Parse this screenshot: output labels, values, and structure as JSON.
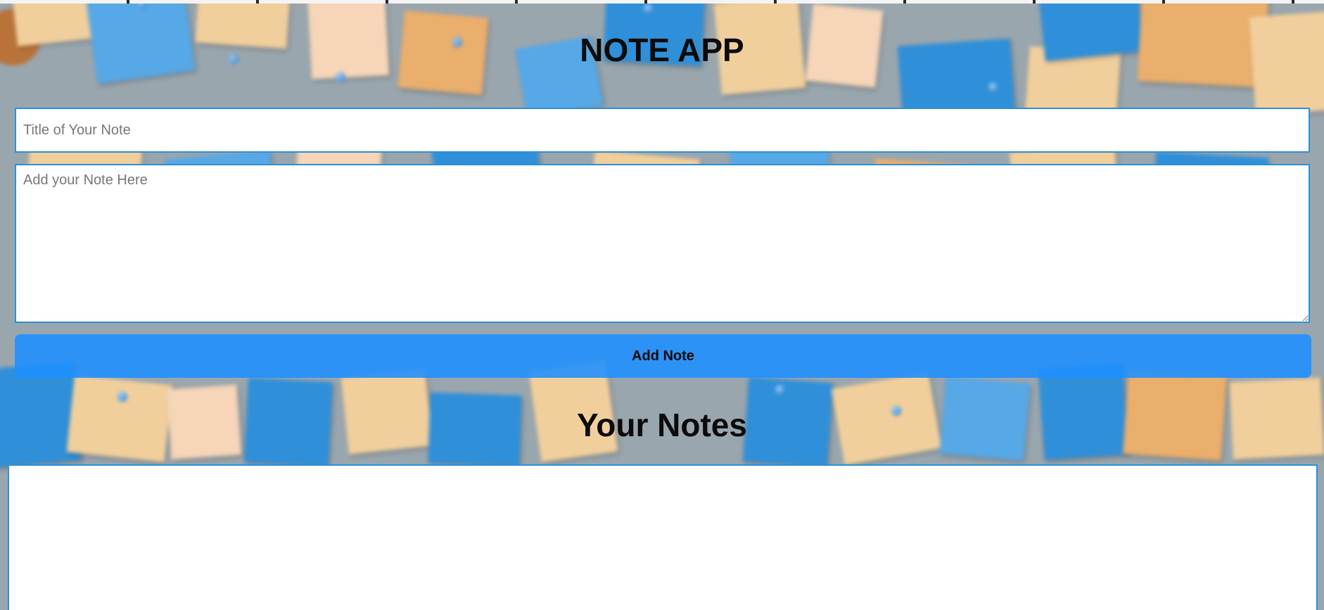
{
  "app": {
    "title": "NOTE APP"
  },
  "form": {
    "title_placeholder": "Title of Your Note",
    "title_value": "",
    "body_placeholder": "Add your Note Here",
    "body_value": "",
    "add_button_label": "Add Note"
  },
  "notes_section": {
    "heading": "Your Notes",
    "items": []
  },
  "colors": {
    "accent": "#2e8fd6",
    "button": "#1e90ff",
    "text": "#0b0b0b"
  }
}
